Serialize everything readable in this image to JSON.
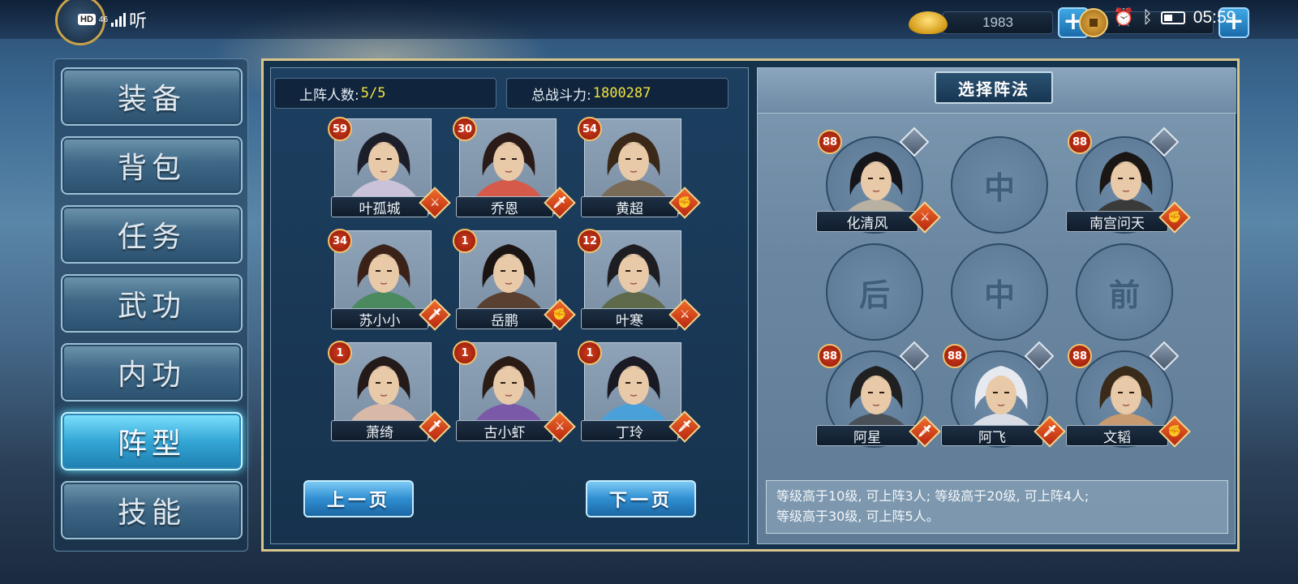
{
  "status_bar": {
    "hd": "HD",
    "net": "46",
    "audio": "听",
    "time": "05:59"
  },
  "resources": {
    "gold": {
      "icon": "gold-ingot-icon",
      "value": "1983"
    },
    "coins": {
      "icon": "copper-coin-icon",
      "value": ""
    },
    "add_symbol": "+"
  },
  "menu": {
    "items": [
      {
        "label": "装备",
        "active": false
      },
      {
        "label": "背包",
        "active": false
      },
      {
        "label": "任务",
        "active": false
      },
      {
        "label": "武功",
        "active": false
      },
      {
        "label": "内功",
        "active": false
      },
      {
        "label": "阵型",
        "active": true
      },
      {
        "label": "技能",
        "active": false
      }
    ]
  },
  "roster": {
    "count_label": "上阵人数:",
    "count_value": "5/5",
    "power_label": "总战斗力:",
    "power_value": "1800287",
    "heroes": [
      {
        "name": "叶孤城",
        "level": "59",
        "class_icon": "sword-icon",
        "hair": "#1c1f2a",
        "robe": "#c9c2d9"
      },
      {
        "name": "乔恩",
        "level": "30",
        "class_icon": "blade-icon",
        "hair": "#2a1a18",
        "robe": "#d65a4a"
      },
      {
        "name": "黄超",
        "level": "54",
        "class_icon": "fist-icon",
        "hair": "#3a2818",
        "robe": "#7a6a58"
      },
      {
        "name": "苏小小",
        "level": "34",
        "class_icon": "blade-icon",
        "hair": "#3b2218",
        "robe": "#4a8a5e"
      },
      {
        "name": "岳鹏",
        "level": "1",
        "class_icon": "fist-icon",
        "hair": "#1a1412",
        "robe": "#5a4030"
      },
      {
        "name": "叶寒",
        "level": "12",
        "class_icon": "sword-icon",
        "hair": "#1e1e22",
        "robe": "#5e6a4a"
      },
      {
        "name": "萧绮",
        "level": "1",
        "class_icon": "blade-icon",
        "hair": "#241a1a",
        "robe": "#d8b9a8"
      },
      {
        "name": "古小虾",
        "level": "1",
        "class_icon": "sword-icon",
        "hair": "#2a1c14",
        "robe": "#7a5aa8"
      },
      {
        "name": "丁玲",
        "level": "1",
        "class_icon": "blade-icon",
        "hair": "#1a1a24",
        "robe": "#4aa0d8"
      }
    ],
    "prev_label": "上一页",
    "next_label": "下一页"
  },
  "formation": {
    "title": "选择阵法",
    "slots": [
      {
        "type": "hero",
        "name": "化清风",
        "level": "88",
        "class_icon": "sword-icon",
        "pet_icon": "bird-pet-icon",
        "hair": "#15151a",
        "robe": "#b8b0a0"
      },
      {
        "type": "empty",
        "label": "中"
      },
      {
        "type": "hero",
        "name": "南宫问天",
        "level": "88",
        "class_icon": "fist-icon",
        "pet_icon": "beast-pet-icon",
        "hair": "#1a1614",
        "robe": "#3a3a3a"
      },
      {
        "type": "empty",
        "label": "后"
      },
      {
        "type": "empty",
        "label": "中"
      },
      {
        "type": "empty",
        "label": "前"
      },
      {
        "type": "hero",
        "name": "阿星",
        "level": "88",
        "class_icon": "blade-icon",
        "pet_icon": "wolf-pet-icon",
        "hair": "#202020",
        "robe": "#4a5058"
      },
      {
        "type": "hero",
        "name": "阿飞",
        "level": "88",
        "class_icon": "blade-icon",
        "pet_icon": "eagle-pet-icon",
        "hair": "#e6eaf0",
        "robe": "#d8dde6"
      },
      {
        "type": "hero",
        "name": "文韬",
        "level": "88",
        "class_icon": "fist-icon",
        "pet_icon": "dog-pet-icon",
        "hair": "#3a2a1a",
        "robe": "#c89a70"
      }
    ],
    "tip_line1": "等级高于10级, 可上阵3人; 等级高于20级, 可上阵4人;",
    "tip_line2": "等级高于30级, 可上阵5人。"
  }
}
